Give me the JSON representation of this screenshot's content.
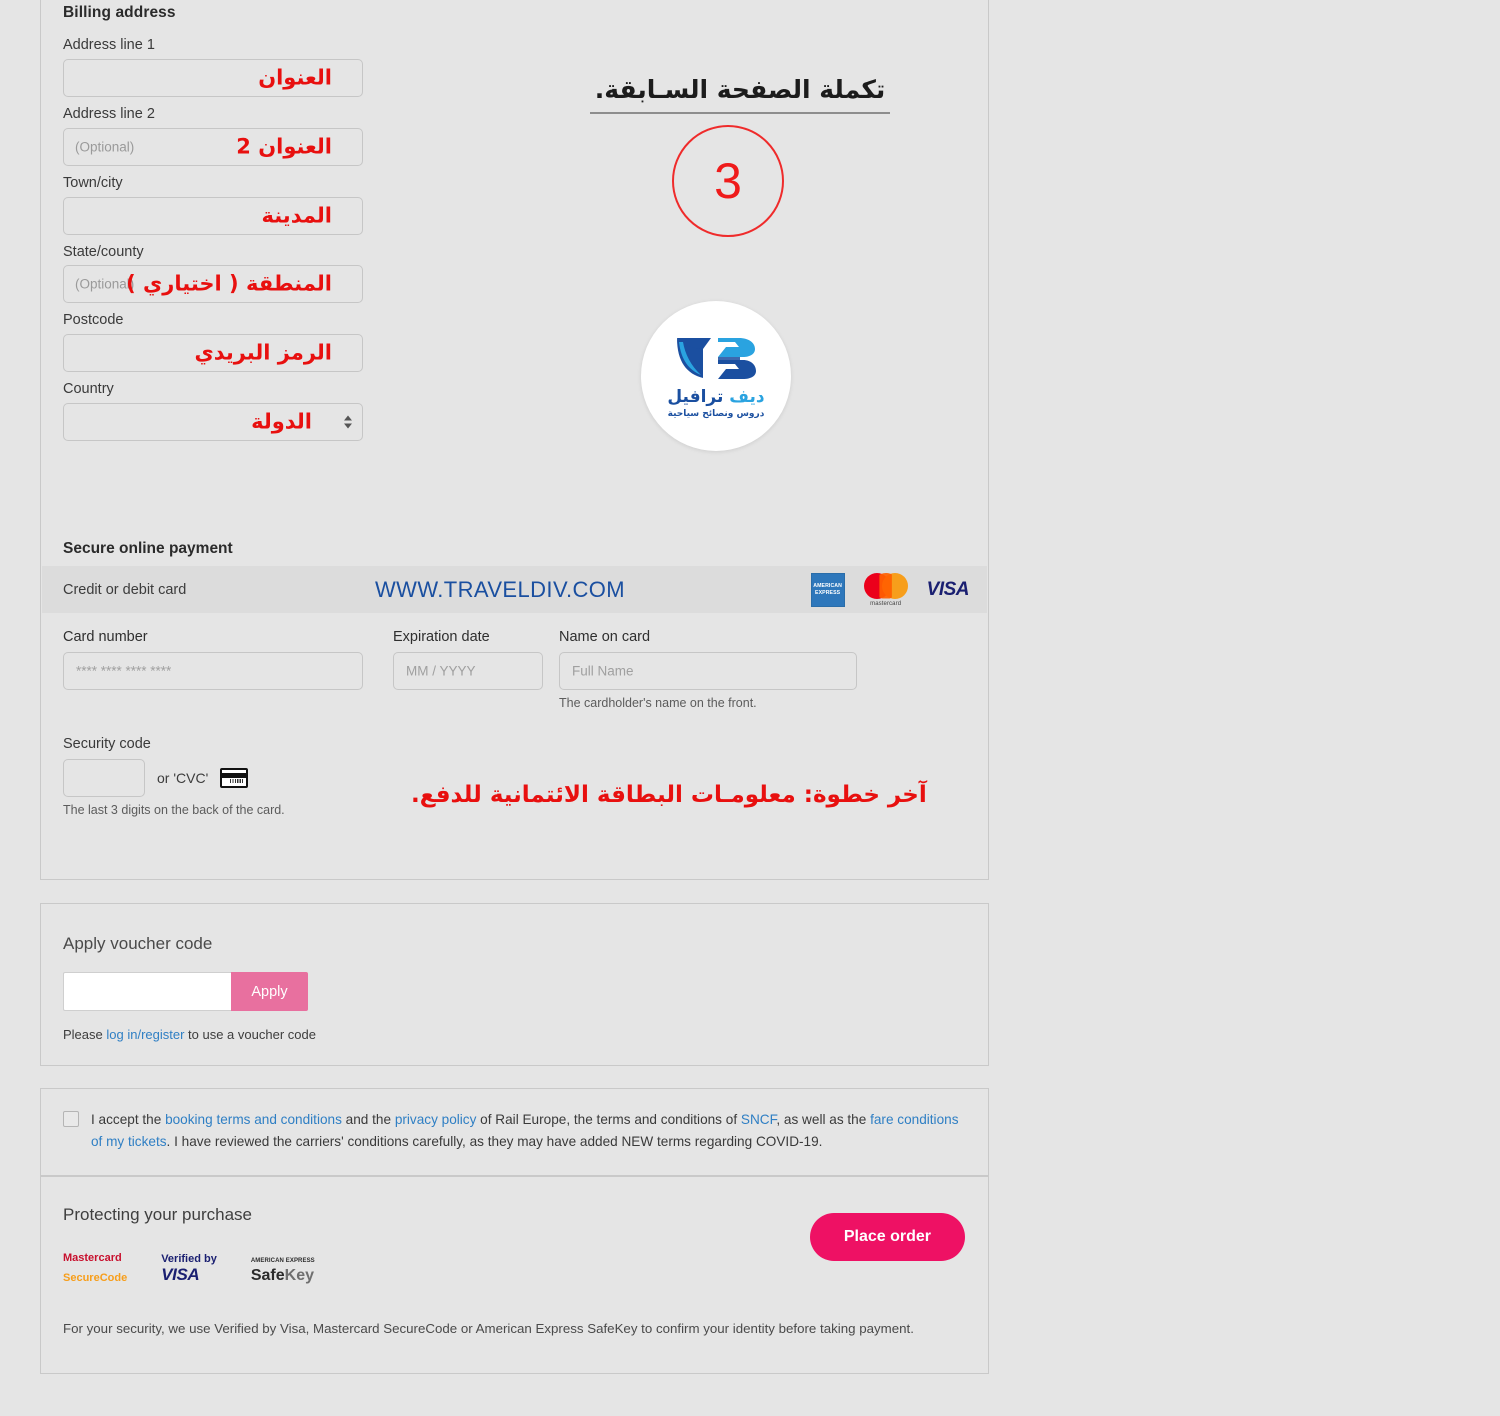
{
  "billing": {
    "section_title": "Billing address",
    "fields": [
      {
        "label": "Address line 1",
        "placeholder": "",
        "note": "العنوان"
      },
      {
        "label": "Address line 2",
        "placeholder": "(Optional)",
        "note": "العنوان 2"
      },
      {
        "label": "Town/city",
        "placeholder": "",
        "note": "المدينة"
      },
      {
        "label": "State/county",
        "placeholder": "(Optional)",
        "note": "المنطقة ( اختياري )"
      },
      {
        "label": "Postcode",
        "placeholder": "",
        "note": "الرمز البريدي"
      },
      {
        "label": "Country",
        "placeholder": "",
        "note": "الدولة"
      }
    ]
  },
  "annotations": {
    "step_heading": "تكملة الصفحة السـابقة.",
    "step_number": "3",
    "payment_note": "آخر خطوة: معلومـات البطاقة الائتمانية للدفع."
  },
  "logo": {
    "name_dark": "ترافيل",
    "name_light": "ديف",
    "tagline": "دروس ونصائح سياحية"
  },
  "payment": {
    "section_title": "Secure online payment",
    "card_row_label": "Credit or debit card",
    "watermark": "WWW.TRAVELDIV.COM",
    "brands": [
      {
        "name": "amex-logo",
        "line1": "AMERICAN",
        "line2": "EXPRESS"
      },
      {
        "name": "mastercard-logo",
        "text": "mastercard"
      },
      {
        "name": "visa-logo",
        "text": "VISA"
      }
    ],
    "card_number": {
      "label": "Card number",
      "placeholder": "**** **** **** ****",
      "value": ""
    },
    "expiration": {
      "label": "Expiration date",
      "placeholder": "MM / YYYY",
      "value": ""
    },
    "name_on_card": {
      "label": "Name on card",
      "placeholder": "Full Name",
      "value": "",
      "hint": "The cardholder's name on the front."
    },
    "security_code": {
      "label": "Security code",
      "value": "",
      "or_text": "or 'CVC'",
      "hint": "The last 3 digits on the back of the card."
    }
  },
  "voucher": {
    "title": "Apply voucher code",
    "input_value": "",
    "apply_label": "Apply",
    "note_before": "Please ",
    "note_link": "log in/register",
    "note_after": " to use a voucher code"
  },
  "terms": {
    "t1": "I accept the ",
    "link1": "booking terms and conditions",
    "t2": " and the ",
    "link2": "privacy policy",
    "t3": " of Rail Europe, the terms and conditions of ",
    "link3": "SNCF",
    "t4": ", as well as the ",
    "link4": "fare conditions of my tickets",
    "t5": ". I have reviewed the carriers' conditions carefully, as they may have added NEW terms regarding COVID-19.",
    "checked": false
  },
  "protecting": {
    "title": "Protecting your purchase",
    "badges": [
      {
        "name": "mastercard-securecode-badge",
        "line1": "Mastercard",
        "line2": "SecureCode"
      },
      {
        "name": "verified-by-visa-badge",
        "line1": "Verified by",
        "line2": "VISA"
      },
      {
        "name": "amex-safekey-badge",
        "line1": "AMERICAN EXPRESS",
        "line2a": "Safe",
        "line2b": "Key"
      }
    ],
    "place_order_label": "Place order",
    "footer": "For your security, we use Verified by Visa, Mastercard SecureCode or American Express SafeKey to confirm your identity before taking payment."
  },
  "colors": {
    "accent_pink": "#ee1164",
    "apply_pink": "#e8709f",
    "annotation_red": "#e8100f",
    "link_blue": "#2f7fc4",
    "background": "#e5e5e5"
  }
}
